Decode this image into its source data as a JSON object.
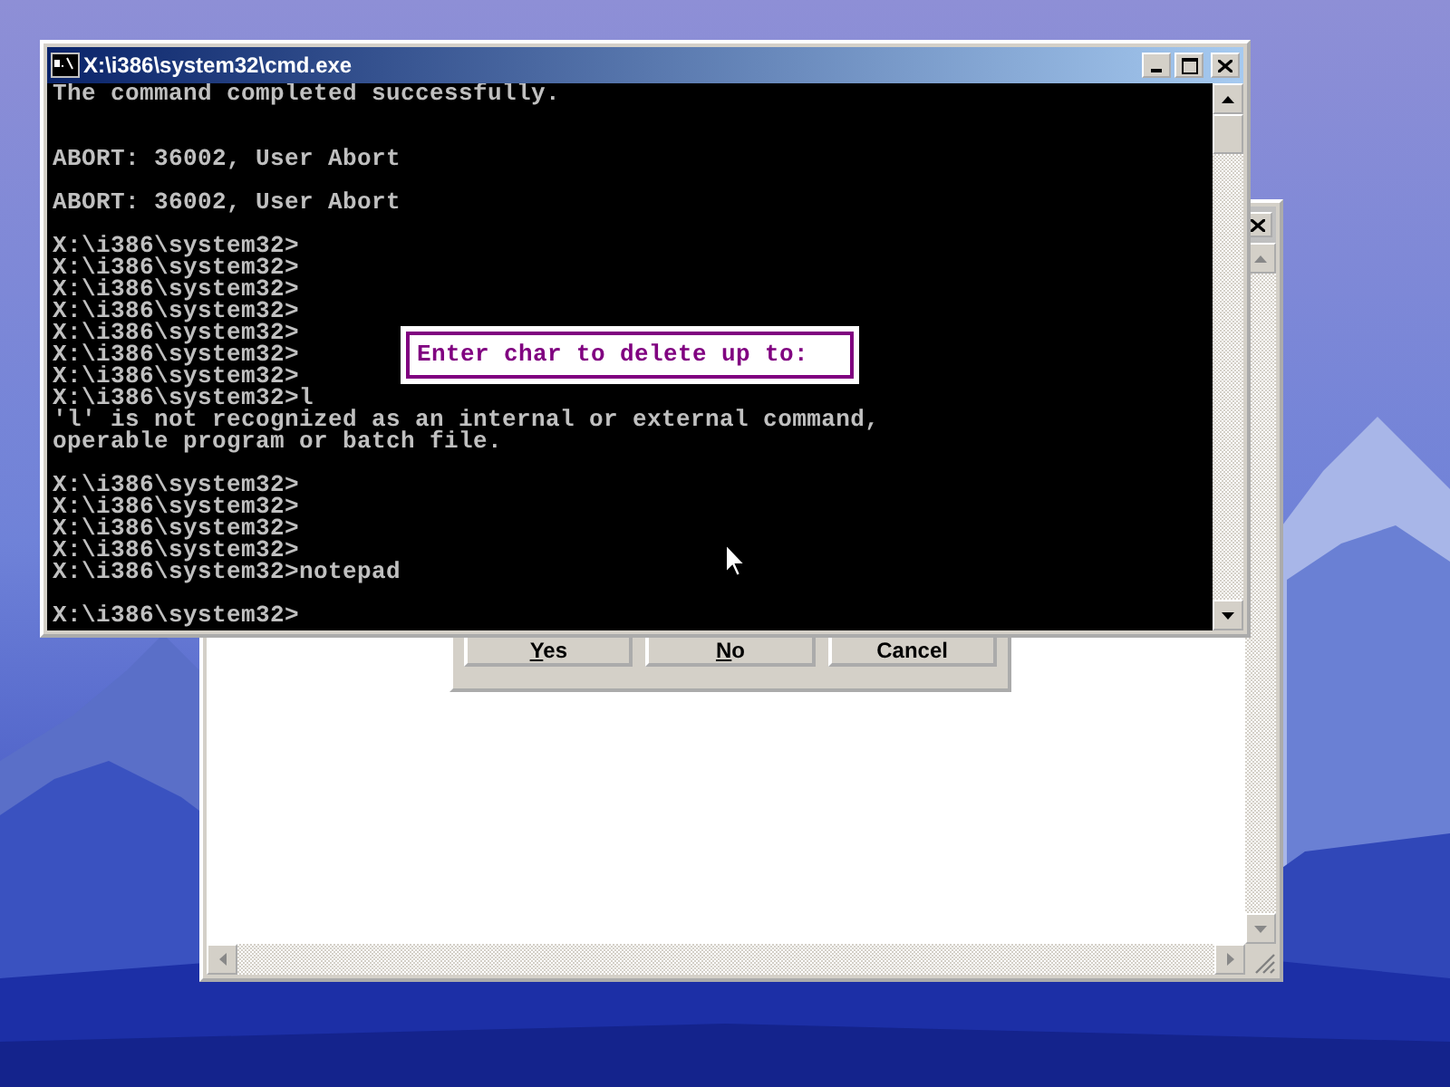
{
  "cmd_window": {
    "title": "X:\\i386\\system32\\cmd.exe",
    "active": true,
    "lines": [
      {
        "kind": "text",
        "text": "The command completed successfully."
      },
      {
        "kind": "blank"
      },
      {
        "kind": "blank"
      },
      {
        "kind": "text",
        "text": "ABORT: 36002, User Abort"
      },
      {
        "kind": "blank"
      },
      {
        "kind": "text",
        "text": "ABORT: 36002, User Abort"
      },
      {
        "kind": "blank"
      },
      {
        "kind": "text",
        "text": "X:\\i386\\system32>"
      },
      {
        "kind": "text",
        "text": "X:\\i386\\system32>"
      },
      {
        "kind": "text",
        "text": "X:\\i386\\system32>"
      },
      {
        "kind": "text",
        "text": "X:\\i386\\system32>"
      },
      {
        "kind": "text",
        "text": "X:\\i386\\system32>"
      },
      {
        "kind": "text",
        "text": "X:\\i386\\system32>"
      },
      {
        "kind": "text",
        "text": "X:\\i386\\system32>"
      },
      {
        "kind": "text",
        "text": "X:\\i386\\system32>l"
      },
      {
        "kind": "text",
        "text": "'l' is not recognized as an internal or external command,"
      },
      {
        "kind": "text",
        "text": "operable program or batch file."
      },
      {
        "kind": "blank"
      },
      {
        "kind": "text",
        "text": "X:\\i386\\system32>"
      },
      {
        "kind": "text",
        "text": "X:\\i386\\system32>"
      },
      {
        "kind": "text",
        "text": "X:\\i386\\system32>"
      },
      {
        "kind": "text",
        "text": "X:\\i386\\system32>"
      },
      {
        "kind": "text",
        "text": "X:\\i386\\system32>notepad"
      },
      {
        "kind": "blank"
      },
      {
        "kind": "text",
        "text": "X:\\i386\\system32>"
      }
    ],
    "popup": {
      "prompt": "Enter char to delete up to:"
    }
  },
  "dialog": {
    "buttons": [
      {
        "label": "Yes",
        "underline_first": true
      },
      {
        "label": "No",
        "underline_first": true
      },
      {
        "label": "Cancel",
        "underline_first": false
      }
    ]
  }
}
